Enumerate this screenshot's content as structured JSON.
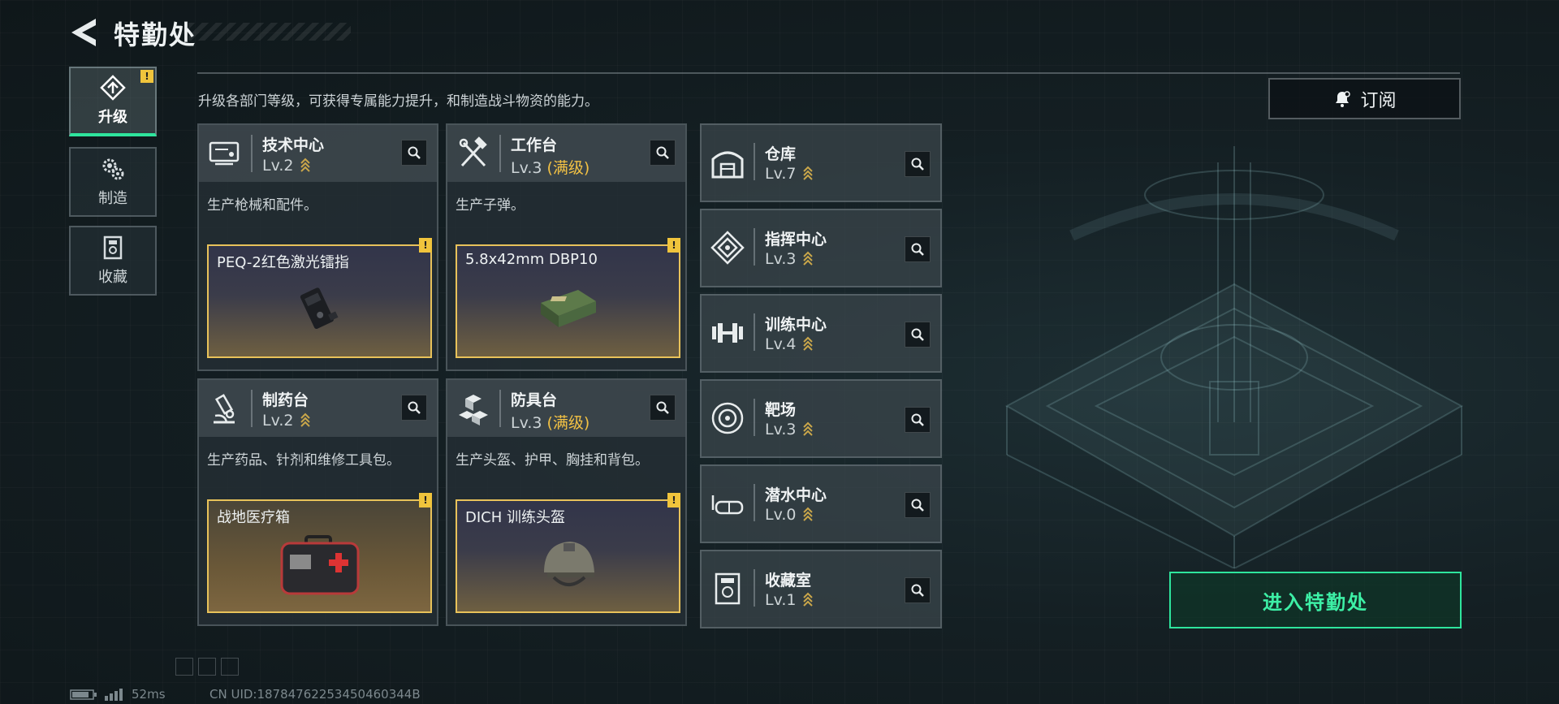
{
  "header": {
    "title": "特勤处"
  },
  "nav": [
    {
      "label": "升级",
      "icon": "upgrade-icon",
      "active": true,
      "badge": "!"
    },
    {
      "label": "制造",
      "icon": "gears-icon",
      "active": false
    },
    {
      "label": "收藏",
      "icon": "collection-icon",
      "active": false
    }
  ],
  "description": "升级各部门等级，可获得专属能力提升，和制造战斗物资的能力。",
  "subscribe": {
    "label": "订阅",
    "icon": "bell-icon"
  },
  "departments": [
    {
      "name": "技术中心",
      "level": "Lv.2",
      "maxed": "",
      "desc": "生产枪械和配件。",
      "item": "PEQ-2红色激光镭指",
      "icon": "tech-center-icon"
    },
    {
      "name": "工作台",
      "level": "Lv.3",
      "maxed": "(满级)",
      "desc": "生产子弹。",
      "item": "5.8x42mm DBP10",
      "icon": "workbench-icon"
    },
    {
      "name": "制药台",
      "level": "Lv.2",
      "maxed": "",
      "desc": "生产药品、针剂和维修工具包。",
      "item": "战地医疗箱",
      "icon": "pharmacy-icon"
    },
    {
      "name": "防具台",
      "level": "Lv.3",
      "maxed": "(满级)",
      "desc": "生产头盔、护甲、胸挂和背包。",
      "item": "DICH 训练头盔",
      "icon": "armor-bench-icon"
    }
  ],
  "facilities": [
    {
      "name": "仓库",
      "level": "Lv.7",
      "icon": "warehouse-icon"
    },
    {
      "name": "指挥中心",
      "level": "Lv.3",
      "icon": "command-center-icon"
    },
    {
      "name": "训练中心",
      "level": "Lv.4",
      "icon": "dumbbell-icon"
    },
    {
      "name": "靶场",
      "level": "Lv.3",
      "icon": "target-icon"
    },
    {
      "name": "潜水中心",
      "level": "Lv.0",
      "icon": "diving-mask-icon"
    },
    {
      "name": "收藏室",
      "level": "Lv.1",
      "icon": "collection-room-icon"
    }
  ],
  "enter_button": "进入特勤处",
  "status": {
    "ping": "52ms",
    "uid": "CN UID:18784762253450460344B"
  },
  "colors": {
    "accent_green": "#2ee59d",
    "warning_yellow": "#f0c43c",
    "max_level": "#f2c144"
  }
}
